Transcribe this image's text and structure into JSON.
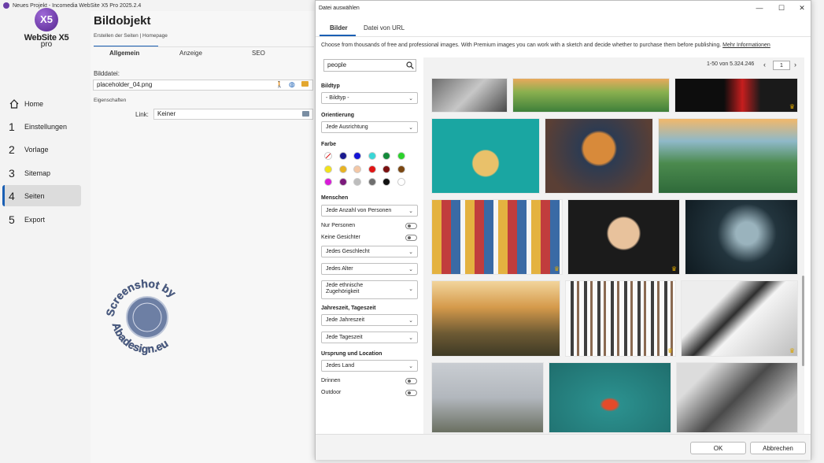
{
  "app": {
    "title": "Neues Projekt - Incomedia WebSite X5 Pro 2025.2.4",
    "brand": "WebSite X5",
    "edition": "pro",
    "logo_letters": "X5"
  },
  "nav": [
    {
      "label": "Home",
      "num": ""
    },
    {
      "label": "Einstellungen",
      "num": "1"
    },
    {
      "label": "Vorlage",
      "num": "2"
    },
    {
      "label": "Sitemap",
      "num": "3"
    },
    {
      "label": "Seiten",
      "num": "4"
    },
    {
      "label": "Export",
      "num": "5"
    }
  ],
  "content": {
    "title": "Bildobjekt",
    "subtitle": "Erstellen der Seiten | Homepage",
    "tabs": [
      "Allgemein",
      "Anzeige",
      "SEO"
    ],
    "file_label": "Bilddatei:",
    "file_value": "placeholder_04.png",
    "props_label": "Eigenschaften",
    "link_label": "Link:",
    "link_value": "Keiner"
  },
  "watermark": {
    "top": "Screenshot by",
    "bottom": "Abadesign.eu"
  },
  "dialog": {
    "title": "Datei auswählen",
    "tabs": [
      "Bilder",
      "Datei von URL"
    ],
    "info": "Choose from thousands of free and professional images. With Premium images you can work with a sketch and decide whether to purchase them before publishing.",
    "info_link": "Mehr Informationen",
    "search_value": "people",
    "bildtyp_label": "Bildtyp",
    "bildtyp_value": "- Bildtyp -",
    "orient_label": "Orientierung",
    "orient_value": "Jede Ausrichtung",
    "farbe_label": "Farbe",
    "colors": [
      "none",
      "#1a1a8f",
      "#1515d6",
      "#39d6d6",
      "#138a3a",
      "#2bd22b",
      "#f2e21a",
      "#e8b323",
      "#f3c7a6",
      "#e01414",
      "#7a1010",
      "#7a4712",
      "#d81bd8",
      "#7b1a7b",
      "#bdbdbd",
      "#6e6e6e",
      "#111111",
      "#ffffff"
    ],
    "menschen_label": "Menschen",
    "menschen_value": "Jede Anzahl von Personen",
    "nur_personen": "Nur Personen",
    "keine_gesichter": "Keine Gesichter",
    "geschlecht_value": "Jedes Geschlecht",
    "alter_value": "Jedes Alter",
    "ethnie_value_1": "Jede ethnische",
    "ethnie_value_2": "Zugehörigkeit",
    "jahreszeit_label": "Jahreszeit, Tageszeit",
    "jahreszeit_value": "Jede Jahreszeit",
    "tageszeit_value": "Jede Tageszeit",
    "ursprung_label": "Ursprung und Location",
    "land_value": "Jedes Land",
    "drinnen": "Drinnen",
    "outdoor": "Outdoor",
    "pager_text": "1-50 von 5.324.246",
    "page_value": "1",
    "ok": "OK",
    "cancel": "Abbrechen"
  },
  "icons": {
    "home": "home-icon",
    "search": "search-icon",
    "crown": "crown-icon",
    "folder": "folder-icon",
    "globe": "globe-icon",
    "person": "person-icon"
  }
}
